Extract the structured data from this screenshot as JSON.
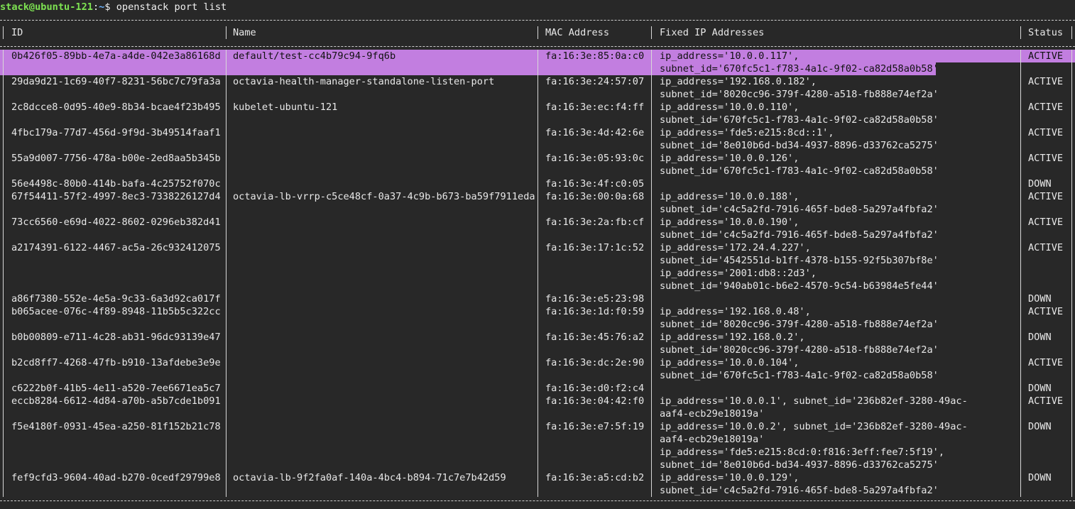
{
  "prompt": {
    "user_host": "stack@ubuntu-121",
    "separator": ":",
    "path": "~",
    "symbol": "$",
    "command": "openstack port list"
  },
  "table": {
    "headers": [
      "ID",
      "Name",
      "MAC Address",
      "Fixed IP Addresses",
      "Status"
    ],
    "selection_color": "#c27ee0",
    "rows": [
      {
        "id": "0b426f05-89bb-4e7a-a4de-042e3a86168d",
        "name": "default/test-cc4b79c94-9fq6b",
        "mac": "fa:16:3e:85:0a:c0",
        "status": "ACTIVE",
        "ips": [
          "ip_address='10.0.0.117',",
          "subnet_id='670fc5c1-f783-4a1c-9f02-ca82d58a0b58'"
        ],
        "selected": true
      },
      {
        "id": "29da9d21-1c69-40f7-8231-56bc7c79fa3a",
        "name": "octavia-health-manager-standalone-listen-port",
        "mac": "fa:16:3e:24:57:07",
        "status": "ACTIVE",
        "ips": [
          "ip_address='192.168.0.182',",
          "subnet_id='8020cc96-379f-4280-a518-fb888e74ef2a'"
        ]
      },
      {
        "id": "2c8dcce8-0d95-40e9-8b34-bcae4f23b495",
        "name": "kubelet-ubuntu-121",
        "mac": "fa:16:3e:ec:f4:ff",
        "status": "ACTIVE",
        "ips": [
          "ip_address='10.0.0.110',",
          "subnet_id='670fc5c1-f783-4a1c-9f02-ca82d58a0b58'"
        ]
      },
      {
        "id": "4fbc179a-77d7-456d-9f9d-3b49514faaf1",
        "name": "",
        "mac": "fa:16:3e:4d:42:6e",
        "status": "ACTIVE",
        "ips": [
          "ip_address='fde5:e215:8cd::1',",
          "subnet_id='8e010b6d-bd34-4937-8896-d33762ca5275'"
        ]
      },
      {
        "id": "55a9d007-7756-478a-b00e-2ed8aa5b345b",
        "name": "",
        "mac": "fa:16:3e:05:93:0c",
        "status": "ACTIVE",
        "ips": [
          "ip_address='10.0.0.126',",
          "subnet_id='670fc5c1-f783-4a1c-9f02-ca82d58a0b58'"
        ]
      },
      {
        "id": "56e4498c-80b0-414b-bafa-4c25752f070c",
        "name": "",
        "mac": "fa:16:3e:4f:c0:05",
        "status": "DOWN",
        "ips": [
          ""
        ]
      },
      {
        "id": "67f54411-57f2-4997-8ec3-7338226127d4",
        "name": "octavia-lb-vrrp-c5ce48cf-0a37-4c9b-b673-ba59f7911eda",
        "mac": "fa:16:3e:00:0a:68",
        "status": "ACTIVE",
        "ips": [
          "ip_address='10.0.0.188',",
          "subnet_id='c4c5a2fd-7916-465f-bde8-5a297a4fbfa2'"
        ]
      },
      {
        "id": "73cc6560-e69d-4022-8602-0296eb382d41",
        "name": "",
        "mac": "fa:16:3e:2a:fb:cf",
        "status": "ACTIVE",
        "ips": [
          "ip_address='10.0.0.190',",
          "subnet_id='c4c5a2fd-7916-465f-bde8-5a297a4fbfa2'"
        ]
      },
      {
        "id": "a2174391-6122-4467-ac5a-26c932412075",
        "name": "",
        "mac": "fa:16:3e:17:1c:52",
        "status": "ACTIVE",
        "ips": [
          "ip_address='172.24.4.227',",
          "subnet_id='4542551d-b1ff-4378-b155-92f5b307bf8e'",
          "ip_address='2001:db8::2d3',",
          "subnet_id='940ab01c-b6e2-4570-9c54-b63984e5fe44'"
        ]
      },
      {
        "id": "a86f7380-552e-4e5a-9c33-6a3d92ca017f",
        "name": "",
        "mac": "fa:16:3e:e5:23:98",
        "status": "DOWN",
        "ips": [
          ""
        ]
      },
      {
        "id": "b065acee-076c-4f89-8948-11b5b5c322cc",
        "name": "",
        "mac": "fa:16:3e:1d:f0:59",
        "status": "ACTIVE",
        "ips": [
          "ip_address='192.168.0.48',",
          "subnet_id='8020cc96-379f-4280-a518-fb888e74ef2a'"
        ]
      },
      {
        "id": "b0b00809-e711-4c28-ab31-96dc93139e47",
        "name": "",
        "mac": "fa:16:3e:45:76:a2",
        "status": "DOWN",
        "ips": [
          "ip_address='192.168.0.2',",
          "subnet_id='8020cc96-379f-4280-a518-fb888e74ef2a'"
        ]
      },
      {
        "id": "b2cd8ff7-4268-47fb-b910-13afdebe3e9e",
        "name": "",
        "mac": "fa:16:3e:dc:2e:90",
        "status": "ACTIVE",
        "ips": [
          "ip_address='10.0.0.104',",
          "subnet_id='670fc5c1-f783-4a1c-9f02-ca82d58a0b58'"
        ]
      },
      {
        "id": "c6222b0f-41b5-4e11-a520-7ee6671ea5c7",
        "name": "",
        "mac": "fa:16:3e:d0:f2:c4",
        "status": "DOWN",
        "ips": [
          ""
        ]
      },
      {
        "id": "eccb8284-6612-4d84-a70b-a5b7cde1b091",
        "name": "",
        "mac": "fa:16:3e:04:42:f0",
        "status": "ACTIVE",
        "ips": [
          "ip_address='10.0.0.1', subnet_id='236b82ef-3280-49ac-",
          "aaf4-ecb29e18019a'"
        ]
      },
      {
        "id": "f5e4180f-0931-45ea-a250-81f152b21c78",
        "name": "",
        "mac": "fa:16:3e:e7:5f:19",
        "status": "DOWN",
        "ips": [
          "ip_address='10.0.0.2', subnet_id='236b82ef-3280-49ac-",
          "aaf4-ecb29e18019a'",
          "ip_address='fde5:e215:8cd:0:f816:3eff:fee7:5f19',",
          "subnet_id='8e010b6d-bd34-4937-8896-d33762ca5275'"
        ]
      },
      {
        "id": "fef9cfd3-9604-40ad-b270-0cedf29799e8",
        "name": "octavia-lb-9f2fa0af-140a-4bc4-b894-71c7e7b42d59",
        "mac": "fa:16:3e:a5:cd:b2",
        "status": "DOWN",
        "ips": [
          "ip_address='10.0.0.129',",
          "subnet_id='c4c5a2fd-7916-465f-bde8-5a297a4fbfa2'"
        ]
      }
    ]
  }
}
